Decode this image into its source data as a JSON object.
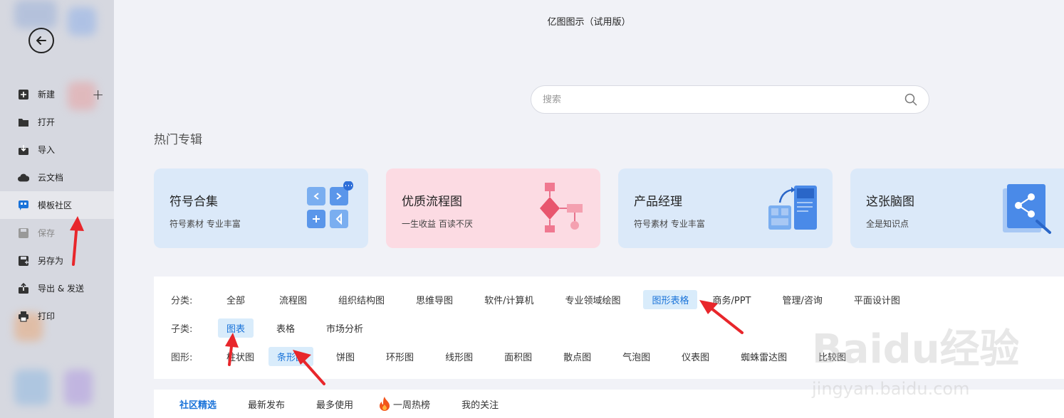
{
  "app": {
    "title": "亿图图示（试用版）"
  },
  "sidebar": {
    "items": [
      {
        "label": "新建",
        "icon": "new-icon"
      },
      {
        "label": "打开",
        "icon": "folder-icon"
      },
      {
        "label": "导入",
        "icon": "import-icon"
      },
      {
        "label": "云文档",
        "icon": "cloud-icon"
      },
      {
        "label": "模板社区",
        "icon": "template-community-icon"
      },
      {
        "label": "保存",
        "icon": "save-icon"
      },
      {
        "label": "另存为",
        "icon": "save-as-icon"
      },
      {
        "label": "导出 & 发送",
        "icon": "export-icon"
      },
      {
        "label": "打印",
        "icon": "print-icon"
      }
    ]
  },
  "search": {
    "placeholder": "搜索"
  },
  "hot": {
    "title": "热门专辑",
    "cards": [
      {
        "title": "符号合集",
        "subtitle": "符号素材 专业丰富",
        "bg": "#dbe9f9"
      },
      {
        "title": "优质流程图",
        "subtitle": "一生收益 百读不厌",
        "bg": "#fcdbe3"
      },
      {
        "title": "产品经理",
        "subtitle": "符号素材 专业丰富",
        "bg": "#dbe9f9"
      },
      {
        "title": "这张脑图",
        "subtitle": "全是知识点",
        "bg": "#dbe9f9"
      }
    ]
  },
  "filters": {
    "category": {
      "label": "分类:",
      "options": [
        "全部",
        "流程图",
        "组织结构图",
        "思维导图",
        "软件/计算机",
        "专业领域绘图",
        "图形表格",
        "商务/PPT",
        "管理/咨询",
        "平面设计图"
      ],
      "selected": "图形表格"
    },
    "subcategory": {
      "label": "子类:",
      "options": [
        "图表",
        "表格",
        "市场分析"
      ],
      "selected": "图表"
    },
    "shape": {
      "label": "图形:",
      "options": [
        "柱状图",
        "条形图",
        "饼图",
        "环形图",
        "线形图",
        "面积图",
        "散点图",
        "气泡图",
        "仪表图",
        "蜘蛛雷达图",
        "比较图"
      ],
      "selected": "条形图"
    }
  },
  "tabs": [
    {
      "label": "社区精选",
      "active": true
    },
    {
      "label": "最新发布"
    },
    {
      "label": "最多使用"
    },
    {
      "label": "一周热榜",
      "icon": "fire-icon"
    },
    {
      "label": "我的关注"
    }
  ],
  "colors": {
    "accent": "#1a73d9",
    "selected_bg": "#d9ecfb",
    "annotation_arrow": "#e8262b"
  },
  "watermark": {
    "brand": "Baidu经验",
    "url": "jingyan.baidu.com"
  }
}
